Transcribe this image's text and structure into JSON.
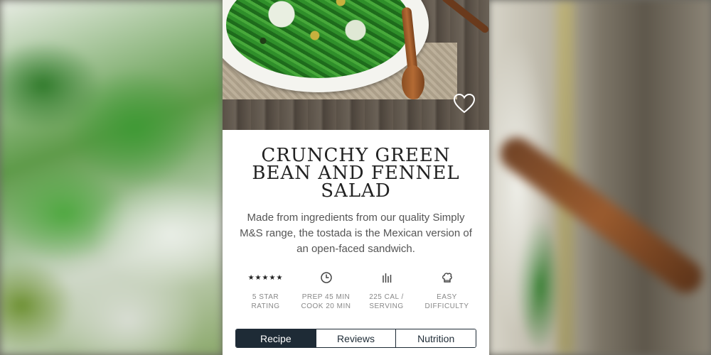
{
  "recipe": {
    "title": "Crunchy Green Bean and Fennel Salad",
    "description": "Made from ingredients from our quality Simply M&S range, the tostada is the Mexican version of an open-faced sandwich.",
    "favorite_icon": "heart-outline-icon"
  },
  "stats": [
    {
      "icon": "five-stars-icon",
      "value": "★★★★★",
      "line1": "5 Star",
      "line2": "Rating"
    },
    {
      "icon": "clock-icon",
      "line1": "Prep 45 min",
      "line2": "Cook 20 min"
    },
    {
      "icon": "bars-icon",
      "line1": "225 cal /",
      "line2": "Serving"
    },
    {
      "icon": "chef-hat-icon",
      "line1": "Easy",
      "line2": "Difficulty"
    }
  ],
  "tabs": [
    {
      "label": "Recipe",
      "active": true
    },
    {
      "label": "Reviews",
      "active": false
    },
    {
      "label": "Nutrition",
      "active": false
    }
  ],
  "colors": {
    "accent": "#1e2b36",
    "text": "#222222",
    "muted": "#888888"
  }
}
